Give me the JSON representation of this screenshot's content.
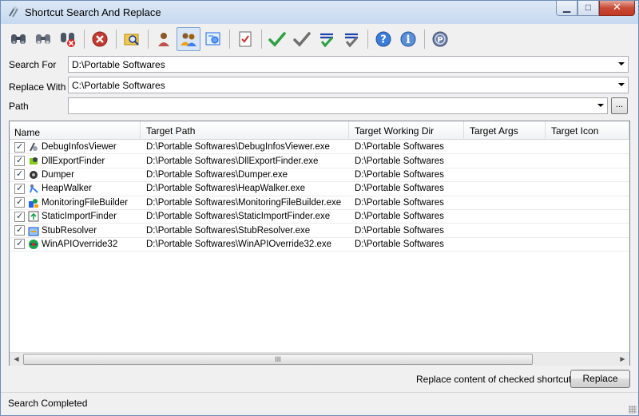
{
  "window": {
    "title": "Shortcut Search And Replace",
    "controls": {
      "minimize": "▁",
      "maximize": "□",
      "close": "✕"
    }
  },
  "toolbar": {
    "icons": [
      "binoculars-icon",
      "binoculars-next-icon",
      "binoculars-delete-icon",
      "stop-icon",
      "search-folder-icon",
      "user-icon",
      "users-icon",
      "options-icon",
      "checklist-icon",
      "check-all-icon",
      "uncheck-all-icon",
      "check-selected-icon",
      "uncheck-selected-icon",
      "help-icon",
      "info-icon",
      "donate-icon"
    ],
    "pressed": "users-icon"
  },
  "form": {
    "search_label": "Search For",
    "search_value": "D:\\Portable Softwares",
    "replace_label": "Replace With",
    "replace_value": "C:\\Portable Softwares",
    "path_label": "Path",
    "path_value": "",
    "browse_label": "..."
  },
  "list": {
    "columns": [
      "Name",
      "Target Path",
      "Target Working Dir",
      "Target Args",
      "Target Icon"
    ],
    "rows": [
      {
        "name": "DebugInfosViewer",
        "target_path": "D:\\Portable Softwares\\DebugInfosViewer.exe",
        "working_dir": "D:\\Portable Softwares",
        "args": "",
        "icon": "",
        "checked": true
      },
      {
        "name": "DllExportFinder",
        "target_path": "D:\\Portable Softwares\\DllExportFinder.exe",
        "working_dir": "D:\\Portable Softwares",
        "args": "",
        "icon": "",
        "checked": true
      },
      {
        "name": "Dumper",
        "target_path": "D:\\Portable Softwares\\Dumper.exe",
        "working_dir": "D:\\Portable Softwares",
        "args": "",
        "icon": "",
        "checked": true
      },
      {
        "name": "HeapWalker",
        "target_path": "D:\\Portable Softwares\\HeapWalker.exe",
        "working_dir": "D:\\Portable Softwares",
        "args": "",
        "icon": "",
        "checked": true
      },
      {
        "name": "MonitoringFileBuilder",
        "target_path": "D:\\Portable Softwares\\MonitoringFileBuilder.exe",
        "working_dir": "D:\\Portable Softwares",
        "args": "",
        "icon": "",
        "checked": true
      },
      {
        "name": "StaticImportFinder",
        "target_path": "D:\\Portable Softwares\\StaticImportFinder.exe",
        "working_dir": "D:\\Portable Softwares",
        "args": "",
        "icon": "",
        "checked": true
      },
      {
        "name": "StubResolver",
        "target_path": "D:\\Portable Softwares\\StubResolver.exe",
        "working_dir": "D:\\Portable Softwares",
        "args": "",
        "icon": "",
        "checked": true
      },
      {
        "name": "WinAPIOverride32",
        "target_path": "D:\\Portable Softwares\\WinAPIOverride32.exe",
        "working_dir": "D:\\Portable Softwares",
        "args": "",
        "icon": "",
        "checked": true
      }
    ],
    "scroll_grip": "III"
  },
  "actions": {
    "replace_hint": "Replace content of checked shortcuts",
    "replace_button": "Replace"
  },
  "status": {
    "text": "Search Completed"
  }
}
